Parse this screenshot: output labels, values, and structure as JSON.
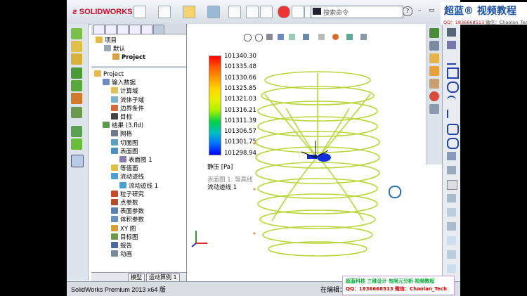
{
  "app": {
    "logo": "SOLIDWORKS",
    "status_left": "SolidWorks Premium 2013 x64 版",
    "status_right": "在编辑："
  },
  "search": {
    "placeholder": "搜索命令",
    "help": "?"
  },
  "watermark": {
    "title": "超蓝® 视频教程",
    "qq": "QQ：1836668513",
    "wechat": "微信：Chaolan_Tech"
  },
  "brand_bar": {
    "line1": "超蓝科技  三维设计  有限元分析  视频教程",
    "line2": "QQ：1836668513   微信：Chaolan_Tech"
  },
  "tree_top": [
    {
      "label": "项目",
      "level": 0,
      "icon": "folder-icon"
    },
    {
      "label": "默认",
      "level": 1,
      "icon": "config-icon"
    },
    {
      "label": "Project",
      "level": 2,
      "icon": "part-icon",
      "bold": true
    }
  ],
  "tree": [
    {
      "label": "Project",
      "level": 0,
      "icon": "folder-icon"
    },
    {
      "label": "输入数据",
      "level": 1,
      "icon": "input-icon"
    },
    {
      "label": "计算域",
      "level": 2,
      "icon": "domain-icon"
    },
    {
      "label": "流体子域",
      "level": 2,
      "icon": "subdomain-icon"
    },
    {
      "label": "边界条件",
      "level": 2,
      "icon": "boundary-icon"
    },
    {
      "label": "目标",
      "level": 2,
      "icon": "goal-icon"
    },
    {
      "label": "结果 (3.fld)",
      "level": 1,
      "icon": "results-icon"
    },
    {
      "label": "网格",
      "level": 2,
      "icon": "mesh-icon"
    },
    {
      "label": "切面图",
      "level": 2,
      "icon": "cut-plot-icon"
    },
    {
      "label": "表面图",
      "level": 2,
      "icon": "surface-plot-icon"
    },
    {
      "label": "表面图 1",
      "level": 3,
      "icon": "surface-item-icon"
    },
    {
      "label": "等值面",
      "level": 2,
      "icon": "isosurface-icon"
    },
    {
      "label": "流动迹线",
      "level": 2,
      "icon": "flow-trajectory-icon"
    },
    {
      "label": "流动迹线 1",
      "level": 3,
      "icon": "trajectory-item-icon"
    },
    {
      "label": "粒子研究",
      "level": 2,
      "icon": "particle-icon"
    },
    {
      "label": "点参数",
      "level": 2,
      "icon": "point-param-icon"
    },
    {
      "label": "表面参数",
      "level": 2,
      "icon": "surface-param-icon"
    },
    {
      "label": "体积参数",
      "level": 2,
      "icon": "volume-param-icon"
    },
    {
      "label": "XY 图",
      "level": 2,
      "icon": "xy-plot-icon"
    },
    {
      "label": "目标图",
      "level": 2,
      "icon": "goal-plot-icon"
    },
    {
      "label": "报告",
      "level": 2,
      "icon": "report-icon"
    },
    {
      "label": "动画",
      "level": 2,
      "icon": "animation-icon"
    }
  ],
  "bottom_tabs": [
    "模型",
    "运动算例 1"
  ],
  "legend": {
    "values": [
      "101340.30",
      "101335.48",
      "101330.66",
      "101325.85",
      "101321.03",
      "101316.21",
      "101311.39",
      "101306.57",
      "101301.75",
      "101298.94"
    ],
    "colors": [
      "#ff0000",
      "#ff5a00",
      "#ff9900",
      "#ffd700",
      "#e8f000",
      "#a6f000",
      "#00d04a",
      "#00c0c0",
      "#0070ff",
      "#0000ff"
    ],
    "quantity": "静压 [Pa]",
    "note1": "表面图 1: 等高线",
    "note2": "流动迹线 1"
  },
  "colors": {
    "streamline": "#b8d63a",
    "accent": "#1a4fa0"
  }
}
